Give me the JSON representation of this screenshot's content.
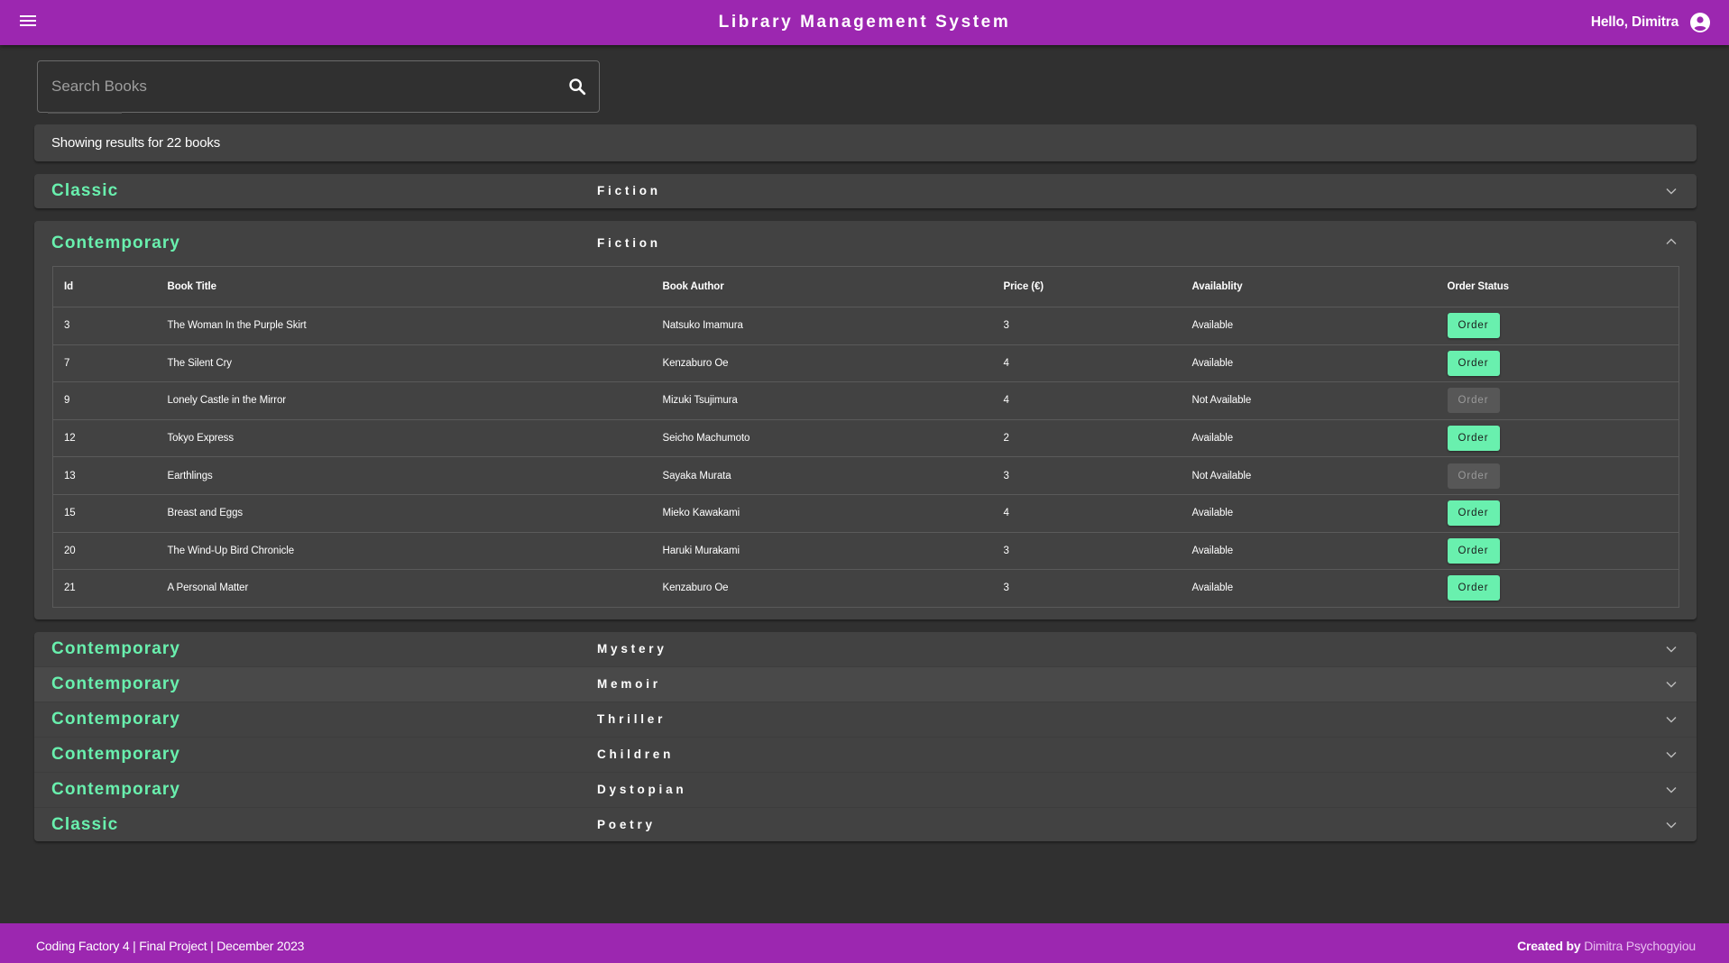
{
  "header": {
    "title": "Library Management System",
    "greeting": "Hello, Dimitra",
    "menu_icon": "hamburger-menu-icon",
    "user_icon": "account-circle-icon"
  },
  "search": {
    "placeholder": "Search Books",
    "value": "",
    "icon": "search-icon"
  },
  "results": {
    "summary": "Showing results for 22 books"
  },
  "colors": {
    "brand": "#9c27b0",
    "accent": "#69f0ae",
    "background": "#303030",
    "panel": "#424242"
  },
  "panels": [
    {
      "category": "Classic",
      "genre": "Fiction",
      "expanded": false
    },
    {
      "category": "Contemporary",
      "genre": "Fiction",
      "expanded": true
    },
    {
      "category": "Contemporary",
      "genre": "Mystery",
      "expanded": false
    },
    {
      "category": "Contemporary",
      "genre": "Memoir",
      "expanded": false
    },
    {
      "category": "Contemporary",
      "genre": "Thriller",
      "expanded": false
    },
    {
      "category": "Contemporary",
      "genre": "Children",
      "expanded": false
    },
    {
      "category": "Contemporary",
      "genre": "Dystopian",
      "expanded": false
    },
    {
      "category": "Classic",
      "genre": "Poetry",
      "expanded": false
    }
  ],
  "table": {
    "columns": [
      "Id",
      "Book Title",
      "Book Author",
      "Price (€)",
      "Availablity",
      "Order Status"
    ],
    "order_label": "Order",
    "rows": [
      {
        "id": "3",
        "title": "The Woman In the Purple Skirt",
        "author": "Natsuko Imamura",
        "price": "3",
        "availability": "Available",
        "orderable": true
      },
      {
        "id": "7",
        "title": "The Silent Cry",
        "author": "Kenzaburo Oe",
        "price": "4",
        "availability": "Available",
        "orderable": true
      },
      {
        "id": "9",
        "title": "Lonely Castle in the Mirror",
        "author": "Mizuki Tsujimura",
        "price": "4",
        "availability": "Not Available",
        "orderable": false
      },
      {
        "id": "12",
        "title": "Tokyo Express",
        "author": "Seicho Machumoto",
        "price": "2",
        "availability": "Available",
        "orderable": true
      },
      {
        "id": "13",
        "title": "Earthlings",
        "author": "Sayaka Murata",
        "price": "3",
        "availability": "Not Available",
        "orderable": false
      },
      {
        "id": "15",
        "title": "Breast and Eggs",
        "author": "Mieko Kawakami",
        "price": "4",
        "availability": "Available",
        "orderable": true
      },
      {
        "id": "20",
        "title": "The Wind-Up Bird Chronicle",
        "author": "Haruki Murakami",
        "price": "3",
        "availability": "Available",
        "orderable": true
      },
      {
        "id": "21",
        "title": "A Personal Matter",
        "author": "Kenzaburo Oe",
        "price": "3",
        "availability": "Available",
        "orderable": true
      }
    ]
  },
  "footer": {
    "left_text": "Coding Factory 4 | Final Project | December 2023",
    "created_by_label": "Created by",
    "author_link": "Dimitra Psychogyiou"
  }
}
